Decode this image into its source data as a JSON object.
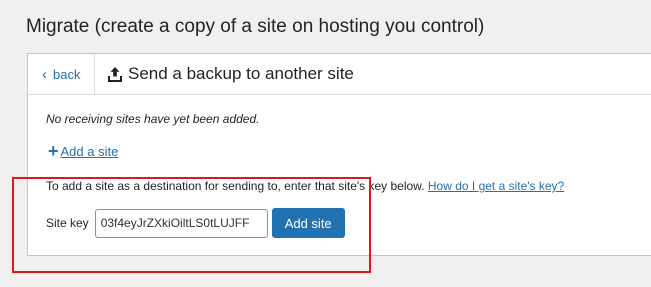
{
  "page": {
    "heading": "Migrate (create a copy of a site on hosting you control)"
  },
  "panel": {
    "back_label": "back",
    "title": "Send a backup to another site",
    "no_sites_message": "No receiving sites have yet been added.",
    "add_site_link": "Add a site",
    "instruction_text": "To add a site as a destination for sending to, enter that site's key below.",
    "help_link": "How do I get a site's key?",
    "site_key_label": "Site key",
    "site_key_value": "03f4eyJrZXkiOiltLS0tLUJFF",
    "add_site_button": "Add site"
  },
  "icons": {
    "back": "chevron-left-icon",
    "upload": "upload-icon",
    "plus": "plus-icon"
  },
  "colors": {
    "accent": "#2271b1",
    "highlight": "#e0171f",
    "background": "#f0f0f1"
  }
}
